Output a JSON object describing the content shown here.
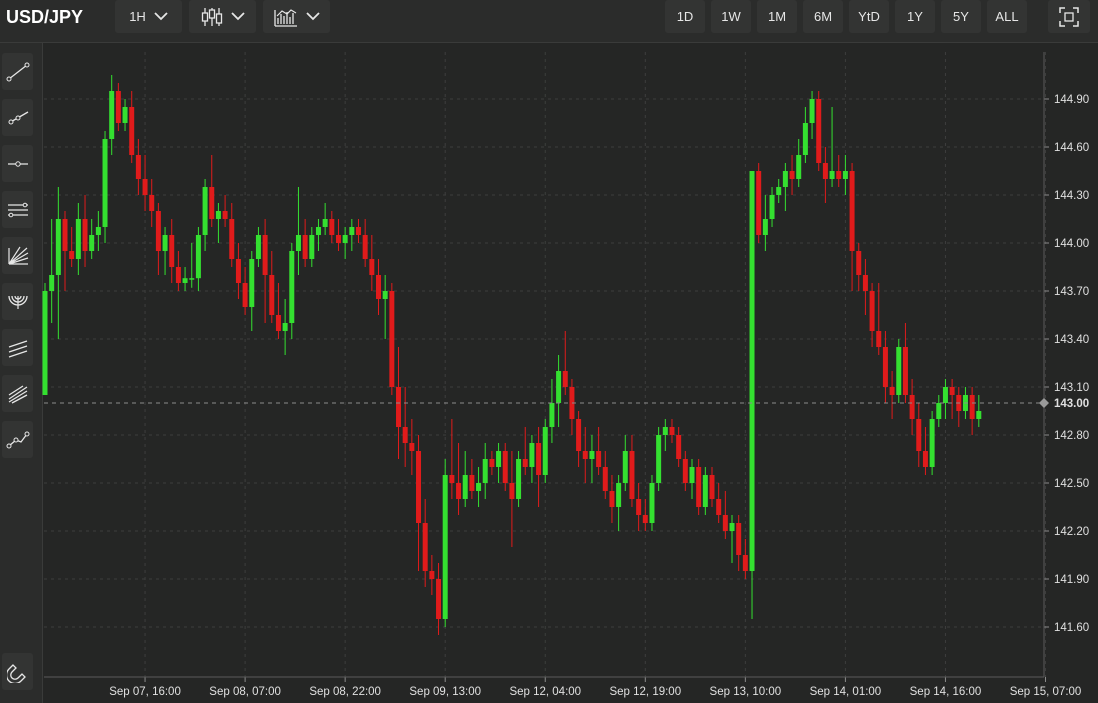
{
  "toolbar": {
    "symbol": "USD/JPY",
    "interval_label": "1H",
    "ranges": [
      "1D",
      "1W",
      "1M",
      "6M",
      "YtD",
      "1Y",
      "5Y",
      "ALL"
    ]
  },
  "icons": {
    "interval_chevron": "chevron-down-icon",
    "chart_type": "candlestick-icon",
    "indicators": "indicators-icon",
    "fullscreen": "fullscreen-icon",
    "left_tools": [
      "trend-line-icon",
      "ray-icon",
      "horizontal-line-icon",
      "parallel-channel-icon",
      "fan-icon",
      "arc-icon",
      "regression-channel-icon",
      "pitchfork-icon",
      "polyline-icon",
      "magnet-icon"
    ]
  },
  "colors": {
    "background": "#252625",
    "up": "#34e030",
    "down": "#e01b1b",
    "grid": "#3d3e3d"
  },
  "chart_data": {
    "type": "candlestick",
    "interval": "1H",
    "y_ticks": [
      "144.90",
      "144.60",
      "144.30",
      "144.00",
      "143.70",
      "143.40",
      "143.10",
      "142.80",
      "142.50",
      "142.20",
      "141.90",
      "141.60"
    ],
    "ylim": [
      141.45,
      145.12
    ],
    "current_price_label": "143.00",
    "current_price": 143.0,
    "x_ticks": [
      "Sep 07, 16:00",
      "Sep 08, 07:00",
      "Sep 08, 22:00",
      "Sep 09, 13:00",
      "Sep 12, 04:00",
      "Sep 12, 19:00",
      "Sep 13, 10:00",
      "Sep 14, 01:00",
      "Sep 14, 16:00",
      "Sep 15, 07:00"
    ],
    "x_tick_bar_index": [
      15,
      30,
      45,
      60,
      75,
      90,
      105,
      120,
      135,
      150
    ],
    "grid": true,
    "candles": [
      [
        143.05,
        143.75,
        143.05,
        143.7
      ],
      [
        143.7,
        144.15,
        143.5,
        143.8
      ],
      [
        143.8,
        144.35,
        143.4,
        144.15
      ],
      [
        144.15,
        144.2,
        143.7,
        143.95
      ],
      [
        143.95,
        144.1,
        143.85,
        143.9
      ],
      [
        143.9,
        144.25,
        143.8,
        144.15
      ],
      [
        144.15,
        144.3,
        143.85,
        143.95
      ],
      [
        143.95,
        144.15,
        143.9,
        144.05
      ],
      [
        144.05,
        144.2,
        143.95,
        144.1
      ],
      [
        144.1,
        144.7,
        144.0,
        144.65
      ],
      [
        144.65,
        145.05,
        144.55,
        144.95
      ],
      [
        144.95,
        145.0,
        144.7,
        144.75
      ],
      [
        144.75,
        144.9,
        144.7,
        144.85
      ],
      [
        144.85,
        144.95,
        144.5,
        144.55
      ],
      [
        144.55,
        144.65,
        144.3,
        144.4
      ],
      [
        144.4,
        144.55,
        144.2,
        144.3
      ],
      [
        144.3,
        144.4,
        144.1,
        144.2
      ],
      [
        144.2,
        144.25,
        143.8,
        143.95
      ],
      [
        143.95,
        144.1,
        143.8,
        144.05
      ],
      [
        144.05,
        144.15,
        143.75,
        143.85
      ],
      [
        143.85,
        143.95,
        143.7,
        143.75
      ],
      [
        143.75,
        143.85,
        143.7,
        143.78
      ],
      [
        143.78,
        144.0,
        143.72,
        143.78
      ],
      [
        143.78,
        144.1,
        143.7,
        144.05
      ],
      [
        144.05,
        144.4,
        143.95,
        144.35
      ],
      [
        144.35,
        144.55,
        144.1,
        144.15
      ],
      [
        144.15,
        144.25,
        144.0,
        144.2
      ],
      [
        144.2,
        144.3,
        144.1,
        144.15
      ],
      [
        144.15,
        144.25,
        143.85,
        143.9
      ],
      [
        143.9,
        144.0,
        143.65,
        143.75
      ],
      [
        143.75,
        143.85,
        143.55,
        143.6
      ],
      [
        143.6,
        143.95,
        143.45,
        143.9
      ],
      [
        143.9,
        144.1,
        143.85,
        144.05
      ],
      [
        144.05,
        144.15,
        143.5,
        143.8
      ],
      [
        143.8,
        143.95,
        143.5,
        143.55
      ],
      [
        143.55,
        143.75,
        143.4,
        143.45
      ],
      [
        143.45,
        143.65,
        143.3,
        143.5
      ],
      [
        143.5,
        144.0,
        143.4,
        143.95
      ],
      [
        143.95,
        144.35,
        143.8,
        144.05
      ],
      [
        144.05,
        144.15,
        143.85,
        143.9
      ],
      [
        143.9,
        144.1,
        143.85,
        144.05
      ],
      [
        144.05,
        144.15,
        143.95,
        144.1
      ],
      [
        144.1,
        144.25,
        144.05,
        144.15
      ],
      [
        144.15,
        144.2,
        144.0,
        144.05
      ],
      [
        144.05,
        144.15,
        143.95,
        144.0
      ],
      [
        144.0,
        144.1,
        143.9,
        144.05
      ],
      [
        144.05,
        144.15,
        143.95,
        144.1
      ],
      [
        144.1,
        144.15,
        144.0,
        144.05
      ],
      [
        144.05,
        144.15,
        143.85,
        143.9
      ],
      [
        143.9,
        144.05,
        143.7,
        143.8
      ],
      [
        143.8,
        143.9,
        143.55,
        143.65
      ],
      [
        143.65,
        143.8,
        143.4,
        143.7
      ],
      [
        143.7,
        143.75,
        143.05,
        143.1
      ],
      [
        143.1,
        143.35,
        142.65,
        142.85
      ],
      [
        142.85,
        143.1,
        142.6,
        142.75
      ],
      [
        142.75,
        142.9,
        142.55,
        142.7
      ],
      [
        142.7,
        142.8,
        141.95,
        142.25
      ],
      [
        142.25,
        142.4,
        141.85,
        141.95
      ],
      [
        141.95,
        142.05,
        141.8,
        141.9
      ],
      [
        141.9,
        142.0,
        141.55,
        141.65
      ],
      [
        141.65,
        142.65,
        141.6,
        142.55
      ],
      [
        142.55,
        142.9,
        142.4,
        142.5
      ],
      [
        142.5,
        142.75,
        142.3,
        142.4
      ],
      [
        142.4,
        142.7,
        142.35,
        142.55
      ],
      [
        142.55,
        142.65,
        142.4,
        142.45
      ],
      [
        142.45,
        142.6,
        142.35,
        142.5
      ],
      [
        142.5,
        142.75,
        142.4,
        142.65
      ],
      [
        142.65,
        142.7,
        142.55,
        142.6
      ],
      [
        142.6,
        142.75,
        142.5,
        142.7
      ],
      [
        142.7,
        142.75,
        142.45,
        142.5
      ],
      [
        142.5,
        142.7,
        142.1,
        142.4
      ],
      [
        142.4,
        142.7,
        142.35,
        142.65
      ],
      [
        142.65,
        142.85,
        142.55,
        142.6
      ],
      [
        142.6,
        142.8,
        142.5,
        142.75
      ],
      [
        142.75,
        142.85,
        142.35,
        142.55
      ],
      [
        142.55,
        142.9,
        142.5,
        142.85
      ],
      [
        142.85,
        143.15,
        142.75,
        143.0
      ],
      [
        143.0,
        143.3,
        142.85,
        143.2
      ],
      [
        143.2,
        143.45,
        143.05,
        143.1
      ],
      [
        143.1,
        143.15,
        142.8,
        142.9
      ],
      [
        142.9,
        142.95,
        142.6,
        142.7
      ],
      [
        142.7,
        142.85,
        142.5,
        142.65
      ],
      [
        142.65,
        142.8,
        142.5,
        142.7
      ],
      [
        142.7,
        142.85,
        142.55,
        142.6
      ],
      [
        142.6,
        142.7,
        142.4,
        142.45
      ],
      [
        142.45,
        142.55,
        142.25,
        142.35
      ],
      [
        142.35,
        142.55,
        142.2,
        142.5
      ],
      [
        142.5,
        142.8,
        142.45,
        142.7
      ],
      [
        142.7,
        142.8,
        142.35,
        142.4
      ],
      [
        142.4,
        142.5,
        142.2,
        142.3
      ],
      [
        142.3,
        142.4,
        142.2,
        142.25
      ],
      [
        142.25,
        142.55,
        142.2,
        142.5
      ],
      [
        142.5,
        142.85,
        142.45,
        142.8
      ],
      [
        142.8,
        142.9,
        142.7,
        142.85
      ],
      [
        142.85,
        142.9,
        142.75,
        142.8
      ],
      [
        142.8,
        142.85,
        142.6,
        142.65
      ],
      [
        142.65,
        142.7,
        142.45,
        142.5
      ],
      [
        142.5,
        142.65,
        142.4,
        142.6
      ],
      [
        142.6,
        142.65,
        142.3,
        142.35
      ],
      [
        142.35,
        142.6,
        142.3,
        142.55
      ],
      [
        142.55,
        142.6,
        142.35,
        142.4
      ],
      [
        142.4,
        142.5,
        142.25,
        142.3
      ],
      [
        142.3,
        142.45,
        142.15,
        142.2
      ],
      [
        142.2,
        142.3,
        142.0,
        142.25
      ],
      [
        142.25,
        142.3,
        141.95,
        142.05
      ],
      [
        142.05,
        142.15,
        141.9,
        141.95
      ],
      [
        141.95,
        144.45,
        141.65,
        144.45
      ],
      [
        144.45,
        144.5,
        144.0,
        144.05
      ],
      [
        144.05,
        144.3,
        143.95,
        144.15
      ],
      [
        144.15,
        144.35,
        144.1,
        144.3
      ],
      [
        144.3,
        144.4,
        144.25,
        144.35
      ],
      [
        144.35,
        144.5,
        144.2,
        144.45
      ],
      [
        144.45,
        144.55,
        144.3,
        144.4
      ],
      [
        144.4,
        144.65,
        144.35,
        144.55
      ],
      [
        144.55,
        144.85,
        144.5,
        144.75
      ],
      [
        144.75,
        144.95,
        144.65,
        144.9
      ],
      [
        144.9,
        144.95,
        144.45,
        144.5
      ],
      [
        144.5,
        144.6,
        144.25,
        144.4
      ],
      [
        144.4,
        144.85,
        144.35,
        144.45
      ],
      [
        144.45,
        144.55,
        144.35,
        144.4
      ],
      [
        144.4,
        144.55,
        144.3,
        144.45
      ],
      [
        144.45,
        144.5,
        143.7,
        143.95
      ],
      [
        143.95,
        144.0,
        143.7,
        143.8
      ],
      [
        143.8,
        143.9,
        143.55,
        143.7
      ],
      [
        143.7,
        143.75,
        143.35,
        143.45
      ],
      [
        143.45,
        143.75,
        143.3,
        143.35
      ],
      [
        143.35,
        143.45,
        143.0,
        143.1
      ],
      [
        143.1,
        143.2,
        142.9,
        143.05
      ],
      [
        143.05,
        143.4,
        143.0,
        143.35
      ],
      [
        143.35,
        143.5,
        143.0,
        143.05
      ],
      [
        143.05,
        143.15,
        142.8,
        142.9
      ],
      [
        142.9,
        143.0,
        142.6,
        142.7
      ],
      [
        142.7,
        142.85,
        142.55,
        142.6
      ],
      [
        142.6,
        142.95,
        142.55,
        142.9
      ],
      [
        142.9,
        143.05,
        142.85,
        143.0
      ],
      [
        143.0,
        143.15,
        142.9,
        143.1
      ],
      [
        143.1,
        143.15,
        142.9,
        143.05
      ],
      [
        143.05,
        143.1,
        142.85,
        142.95
      ],
      [
        142.95,
        143.1,
        142.9,
        143.05
      ],
      [
        143.05,
        143.1,
        142.8,
        142.9
      ],
      [
        142.9,
        143.05,
        142.85,
        142.95
      ]
    ]
  }
}
